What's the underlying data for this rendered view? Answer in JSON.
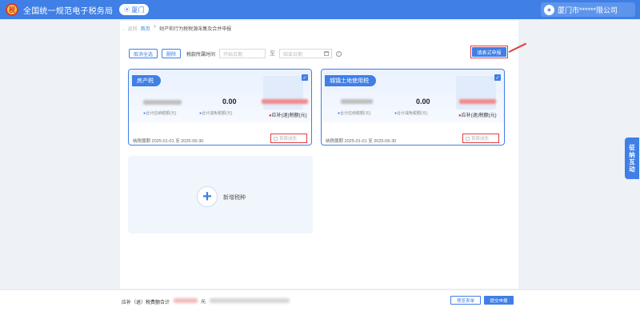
{
  "header": {
    "site_title": "全国统一规范电子税务局",
    "city": "厦门",
    "user_name": "厦门市******限公司"
  },
  "breadcrumb": {
    "back": "← 返回",
    "home": "首页",
    "separator": ">",
    "current": "财产和行为税税源采集及合并申报"
  },
  "toolbar": {
    "deselect_all": "取消全选",
    "delete": "删除",
    "period_label": "税款所属时间",
    "start_placeholder": "开始日期",
    "end_placeholder": "结束日期",
    "range_sep": "至",
    "summary_declare": "填表式申报"
  },
  "cards": [
    {
      "name": "房产税",
      "checked": true,
      "reduction_amount": "0.00",
      "payable_label": "合计应纳税额(元)",
      "reduction_label": "合计减免税额(元)",
      "refund_label": "应补(退)税额(元)",
      "period": "纳税属期 2025-01-01 至 2025-06-30",
      "zero_declare": "首票减免"
    },
    {
      "name": "城镇土地使用税",
      "checked": true,
      "reduction_amount": "0.00",
      "payable_label": "合计应纳税额(元)",
      "reduction_label": "合计减免税额(元)",
      "refund_label": "应补(退)税额(元)",
      "period": "纳税属期 2025-01-01 至 2025-06-30",
      "zero_declare": "首票减免"
    }
  ],
  "add_tax": {
    "label": "新增税种"
  },
  "side_float": {
    "label": "征纳互动"
  },
  "footer": {
    "total_label": "应补（退）税费额合计",
    "unit": "元",
    "preview": "预览表单",
    "submit": "提交申报"
  },
  "colors": {
    "primary": "#3f7fe6",
    "highlight": "#e23c3c"
  }
}
